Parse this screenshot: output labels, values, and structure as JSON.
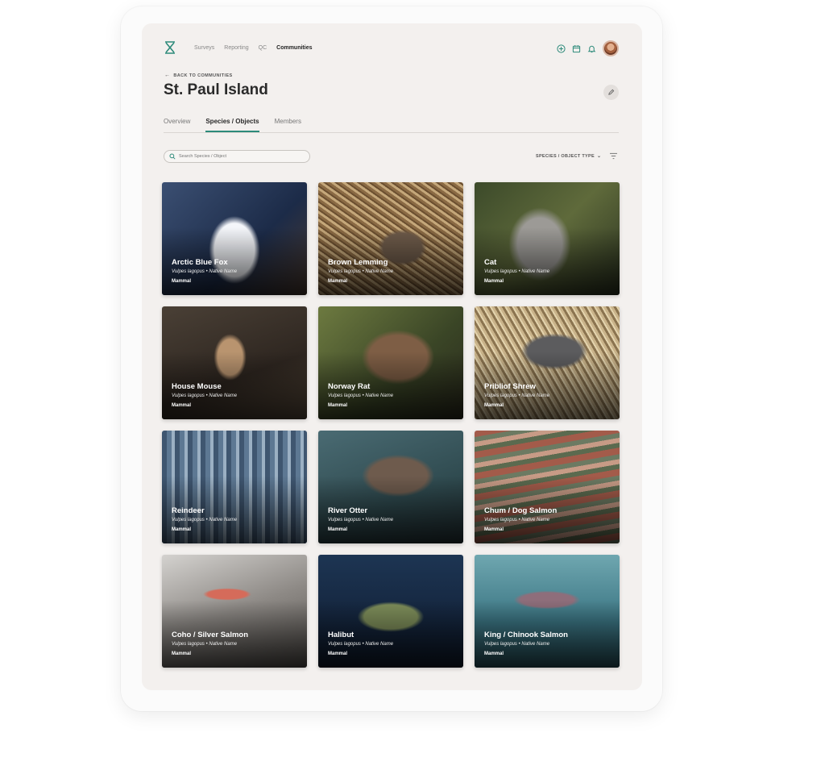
{
  "nav": {
    "links": [
      "Surveys",
      "Reporting",
      "QC",
      "Communities"
    ],
    "active": "Communities"
  },
  "header": {
    "back_label": "BACK TO COMMUNITIES",
    "title": "St. Paul Island"
  },
  "tabs": [
    "Overview",
    "Species / Objects",
    "Members"
  ],
  "active_tab": "Species / Objects",
  "search": {
    "placeholder": "Search Species / Object"
  },
  "filter": {
    "type_label": "SPECIES / OBJECT TYPE"
  },
  "colors": {
    "accent": "#2d8a7a",
    "background": "#f3f0ee"
  },
  "cards": [
    {
      "name": "Arctic Blue Fox",
      "scientific": "Vulpes lagopus • Native Name",
      "type": "Mammal"
    },
    {
      "name": "Brown Lemming",
      "scientific": "Vulpes lagopus • Native Name",
      "type": "Mammal"
    },
    {
      "name": "Cat",
      "scientific": "Vulpes lagopus • Native Name",
      "type": "Mammal"
    },
    {
      "name": "House Mouse",
      "scientific": "Vulpes lagopus • Native Name",
      "type": "Mammal"
    },
    {
      "name": "Norway Rat",
      "scientific": "Vulpes lagopus • Native Name",
      "type": "Mammal"
    },
    {
      "name": "Pribliof Shrew",
      "scientific": "Vulpes lagopus • Native Name",
      "type": "Mammal"
    },
    {
      "name": "Reindeer",
      "scientific": "Vulpes lagopus • Native Name",
      "type": "Mammal"
    },
    {
      "name": "River Otter",
      "scientific": "Vulpes lagopus • Native Name",
      "type": "Mammal"
    },
    {
      "name": "Chum / Dog Salmon",
      "scientific": "Vulpes lagopus • Native Name",
      "type": "Mammal"
    },
    {
      "name": "Coho / Silver Salmon",
      "scientific": "Vulpes lagopus • Native Name",
      "type": "Mammal"
    },
    {
      "name": "Halibut",
      "scientific": "Vulpes lagopus • Native Name",
      "type": "Mammal"
    },
    {
      "name": "King / Chinook Salmon",
      "scientific": "Vulpes lagopus • Native Name",
      "type": "Mammal"
    }
  ]
}
